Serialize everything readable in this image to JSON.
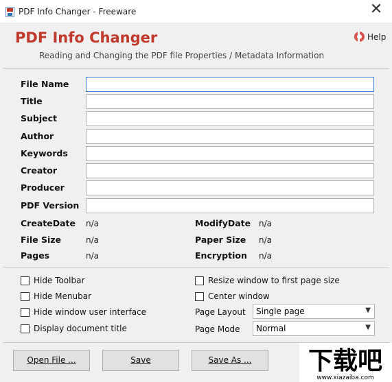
{
  "window": {
    "title": "PDF Info Changer - Freeware",
    "close_glyph": "✕"
  },
  "header": {
    "app_name": "PDF Info Changer",
    "subtitle": "Reading and Changing the PDF file Properties / Metadata Information",
    "help_label": "Help"
  },
  "fields": [
    {
      "label": "File Name",
      "value": ""
    },
    {
      "label": "Title",
      "value": ""
    },
    {
      "label": "Subject",
      "value": ""
    },
    {
      "label": "Author",
      "value": ""
    },
    {
      "label": "Keywords",
      "value": ""
    },
    {
      "label": "Creator",
      "value": ""
    },
    {
      "label": "Producer",
      "value": ""
    },
    {
      "label": "PDF Version",
      "value": ""
    }
  ],
  "info": {
    "create_date_label": "CreateDate",
    "create_date": "n/a",
    "modify_date_label": "ModifyDate",
    "modify_date": "n/a",
    "file_size_label": "File Size",
    "file_size": "n/a",
    "paper_size_label": "Paper Size",
    "paper_size": "n/a",
    "pages_label": "Pages",
    "pages": "n/a",
    "encryption_label": "Encryption",
    "encryption": "n/a"
  },
  "options": {
    "hide_toolbar": "Hide Toolbar",
    "hide_menubar": "Hide Menubar",
    "hide_window_ui": "Hide window user interface",
    "display_doc_title": "Display document title",
    "resize_window": "Resize window to first page size",
    "center_window": "Center window",
    "page_layout_label": "Page Layout",
    "page_layout_value": "Single page",
    "page_mode_label": "Page Mode",
    "page_mode_value": "Normal"
  },
  "buttons": {
    "open_file": "Open File ...",
    "save": "Save",
    "save_as": "Save As ..."
  },
  "watermark": {
    "text": "下载吧",
    "url": "www.xiazaiba.com"
  }
}
